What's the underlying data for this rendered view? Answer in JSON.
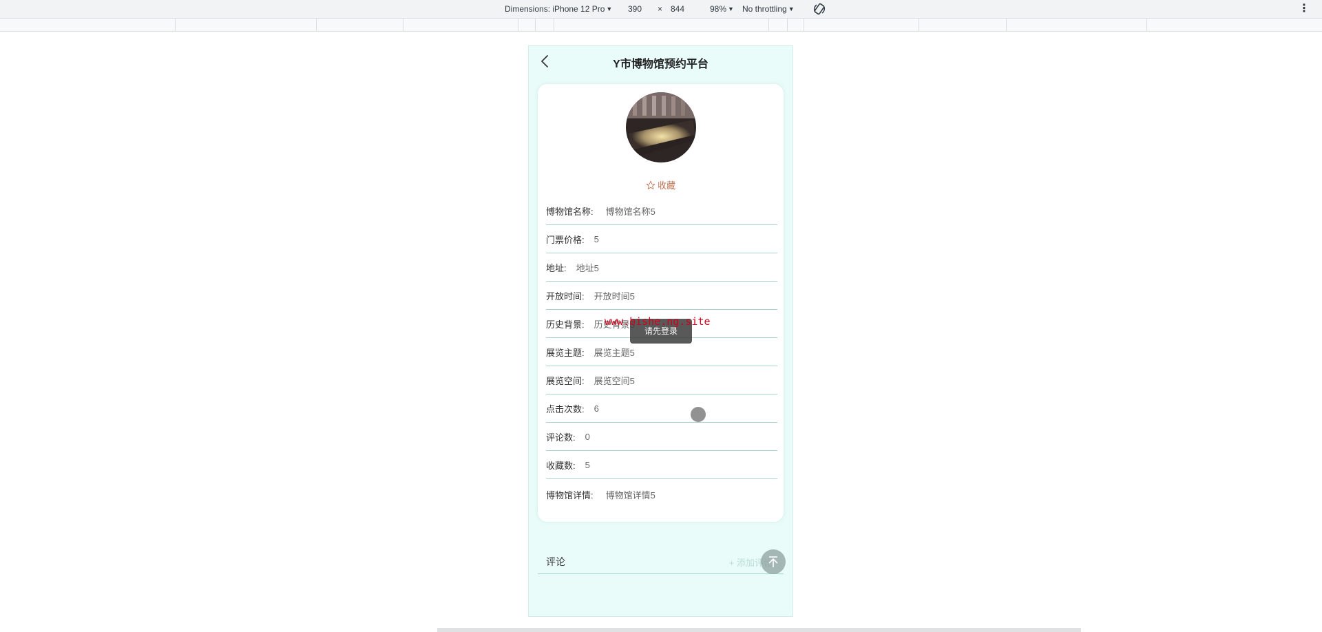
{
  "devtools": {
    "dimensions_label": "Dimensions: iPhone 12 Pro",
    "width": "390",
    "times": "×",
    "height": "844",
    "zoom": "98%",
    "throttling": "No throttling",
    "more_icon": "⋮"
  },
  "app": {
    "title": "Y市博物馆预约平台"
  },
  "museum": {
    "favorite_label": "收藏",
    "fields": [
      {
        "label": "博物馆名称:",
        "value": "博物馆名称5"
      },
      {
        "label": "门票价格:",
        "value": "5"
      },
      {
        "label": "地址:",
        "value": "地址5"
      },
      {
        "label": "开放时间:",
        "value": "开放时间5"
      },
      {
        "label": "历史背景:",
        "value": "历史背景5"
      },
      {
        "label": "展览主题:",
        "value": "展览主题5"
      },
      {
        "label": "展览空间:",
        "value": "展览空间5"
      },
      {
        "label": "点击次数:",
        "value": "6"
      },
      {
        "label": "评论数:",
        "value": "0"
      },
      {
        "label": "收藏数:",
        "value": "5"
      },
      {
        "label": "博物馆详情:",
        "value": "博物馆详情5"
      }
    ]
  },
  "comments": {
    "label": "评论",
    "add_label": "+ 添加评论"
  },
  "toast": "请先登录",
  "watermark": "www.bishe.ng.site",
  "colors": {
    "accent": "#a9d2cd",
    "favorite": "#c0714f",
    "background": "#eafcfa"
  }
}
